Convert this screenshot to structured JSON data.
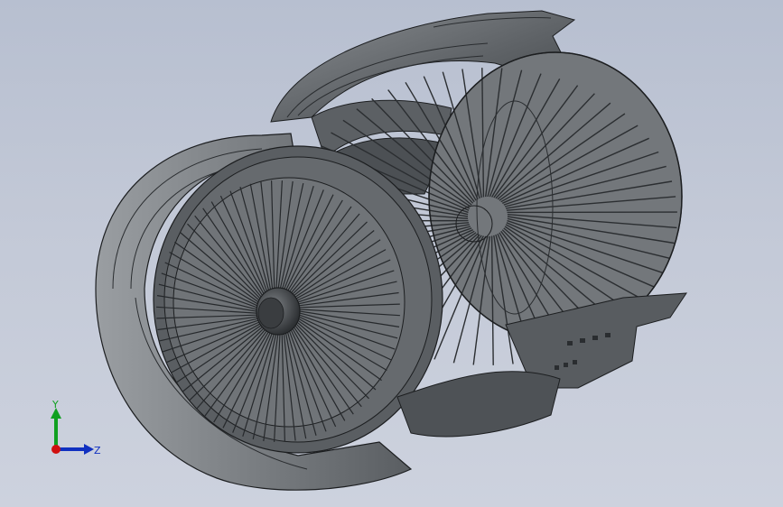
{
  "colors": {
    "background_top": "#b7bfd0",
    "background_bottom": "#cdd2de",
    "model_body": "#6e7276",
    "model_dark": "#3e4246",
    "model_light": "#9a9ea2",
    "edge": "#1c1e20",
    "axis_x": "#d01010",
    "axis_y": "#10a020",
    "axis_z": "#1030c0"
  },
  "triad": {
    "y_label": "Y",
    "z_label": "Z"
  },
  "model": {
    "fan_blade_count": 72,
    "rear_stage_blade_count": 60
  }
}
